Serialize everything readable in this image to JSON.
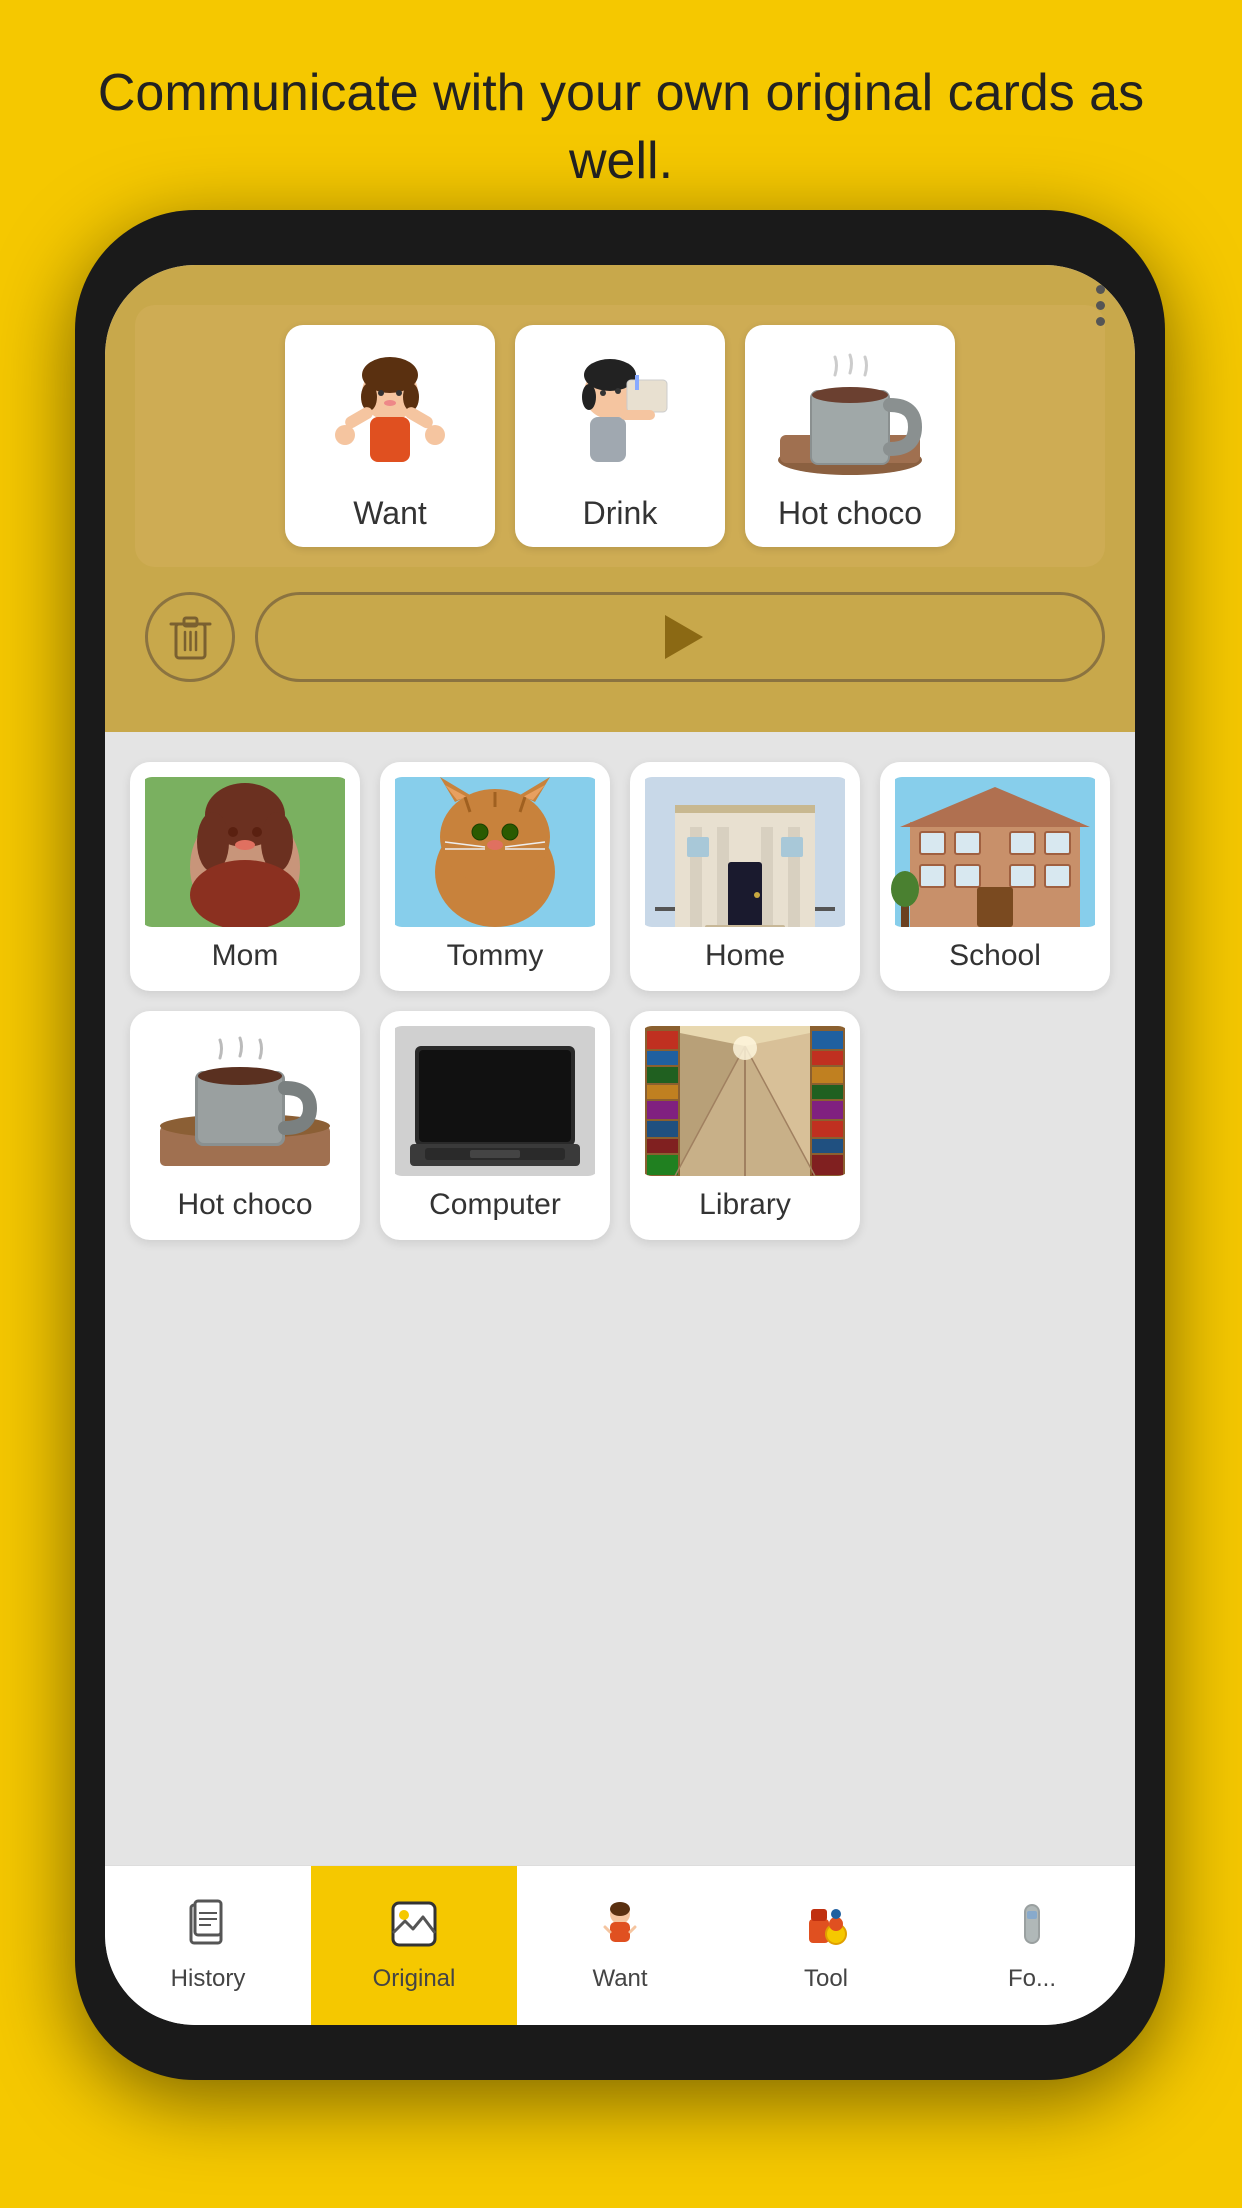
{
  "topText": "Communicate with your own original cards as well.",
  "topCards": [
    {
      "id": "want",
      "label": "Want",
      "type": "illustration-want"
    },
    {
      "id": "drink",
      "label": "Drink",
      "type": "illustration-drink"
    },
    {
      "id": "hot-choco",
      "label": "Hot choco",
      "type": "photo-mug"
    }
  ],
  "gridCards": [
    {
      "id": "mom",
      "label": "Mom",
      "type": "photo-mom"
    },
    {
      "id": "tommy",
      "label": "Tommy",
      "type": "photo-cat"
    },
    {
      "id": "home",
      "label": "Home",
      "type": "photo-door"
    },
    {
      "id": "school",
      "label": "School",
      "type": "photo-school"
    },
    {
      "id": "hot-choco2",
      "label": "Hot choco",
      "type": "photo-mug2"
    },
    {
      "id": "computer",
      "label": "Computer",
      "type": "photo-computer"
    },
    {
      "id": "library",
      "label": "Library",
      "type": "photo-library"
    }
  ],
  "nav": {
    "items": [
      {
        "id": "history",
        "label": "History",
        "icon": "📋",
        "active": false
      },
      {
        "id": "original",
        "label": "Original",
        "icon": "🖼",
        "active": true
      },
      {
        "id": "want",
        "label": "Want",
        "icon": "👧",
        "active": false
      },
      {
        "id": "tool",
        "label": "Tool",
        "icon": "🧸",
        "active": false
      },
      {
        "id": "food",
        "label": "Fo...",
        "icon": "🥤",
        "active": false
      }
    ]
  },
  "buttons": {
    "delete": "Delete",
    "play": "Play"
  }
}
